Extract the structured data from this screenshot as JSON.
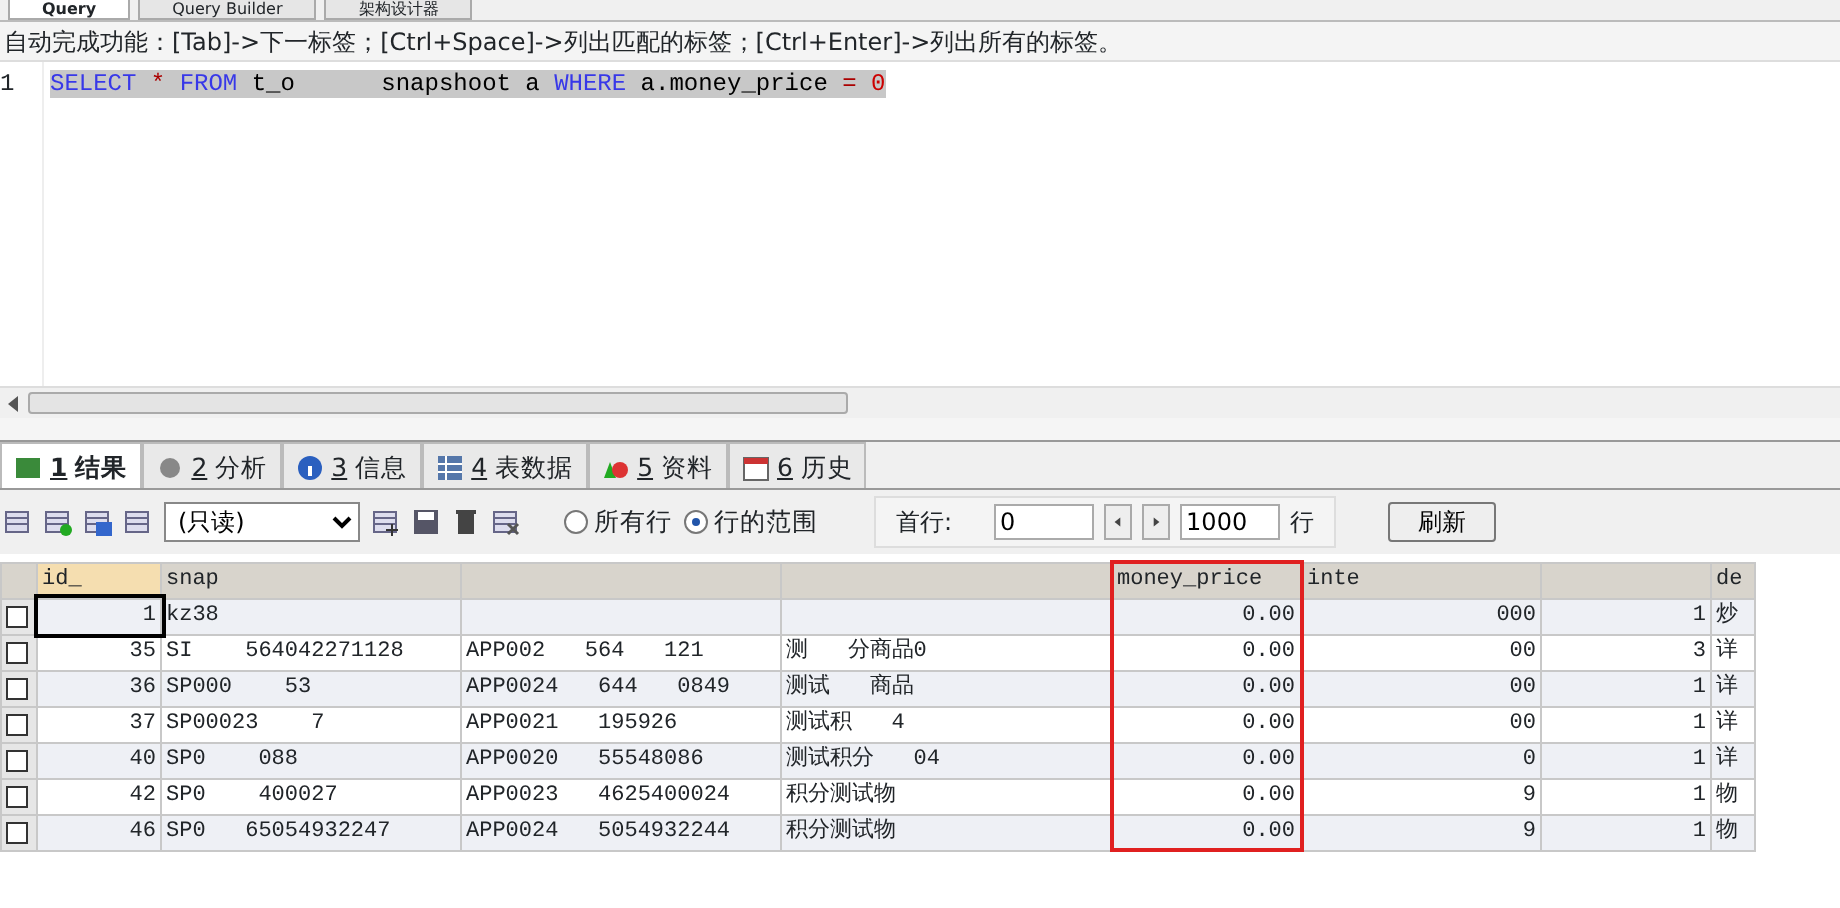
{
  "query_tabs": [
    {
      "label": "Query",
      "selected": true
    },
    {
      "label": "Query Builder",
      "selected": false
    },
    {
      "label": "架构设计器",
      "selected": false
    }
  ],
  "hint": "自动完成功能：[Tab]->下一标签；[Ctrl+Space]->列出匹配的标签；[Ctrl+Enter]->列出所有的标签。",
  "editor": {
    "line_number": "1",
    "tokens": [
      {
        "text": "SELECT",
        "kind": "keyword"
      },
      {
        "text": "*",
        "kind": "operator"
      },
      {
        "text": "FROM",
        "kind": "keyword"
      },
      {
        "text": "t_o      snapshoot a",
        "kind": "plain"
      },
      {
        "text": "WHERE",
        "kind": "keyword"
      },
      {
        "text": "a.money_price",
        "kind": "plain"
      },
      {
        "text": "=",
        "kind": "operator"
      },
      {
        "text": "0",
        "kind": "number"
      }
    ]
  },
  "result_tabs": [
    {
      "number": "1",
      "label": "结果",
      "selected": true
    },
    {
      "number": "2",
      "label": "分析",
      "selected": false
    },
    {
      "number": "3",
      "label": "信息",
      "selected": false
    },
    {
      "number": "4",
      "label": "表数据",
      "selected": false
    },
    {
      "number": "5",
      "label": "资料",
      "selected": false
    },
    {
      "number": "6",
      "label": "历史",
      "selected": false
    }
  ],
  "toolbar": {
    "mode": "(只读)",
    "radios": [
      {
        "label": "所有行",
        "selected": false
      },
      {
        "label": "行的范围",
        "selected": true
      }
    ],
    "first_row_label": "首行:",
    "first_row": "0",
    "row_count": "1000",
    "rows_label": "行",
    "refresh": "刷新"
  },
  "table": {
    "columns": [
      {
        "label": "id_",
        "kind": "numeric",
        "highlighted": false
      },
      {
        "label": "snap",
        "kind": "text",
        "highlighted": false
      },
      {
        "kind": "text",
        "highlighted": false
      },
      {
        "kind": "text",
        "highlighted": false
      },
      {
        "label": "money_price",
        "kind": "numeric",
        "highlighted": true
      },
      {
        "label": "inte",
        "kind": "numeric",
        "highlighted": false
      },
      {
        "kind": "numeric",
        "highlighted": false
      },
      {
        "label": "de",
        "kind": "text",
        "highlighted": false
      }
    ],
    "rows": [
      {
        "selected": false,
        "cells": [
          "1",
          "kz38",
          "",
          "",
          "0.00",
          "000",
          "1",
          "炒"
        ]
      },
      {
        "selected": false,
        "cells": [
          "35",
          "SI    564042271128",
          "APP002   564   121",
          "测   分商品0",
          "0.00",
          "00",
          "3",
          "详"
        ]
      },
      {
        "selected": false,
        "cells": [
          "36",
          "SP000    53",
          "APP0024   644   0849",
          "测试   商品",
          "0.00",
          "00",
          "1",
          "详"
        ]
      },
      {
        "selected": false,
        "cells": [
          "37",
          "SP00023    7",
          "APP0021   195926",
          "测试积   4",
          "0.00",
          "00",
          "1",
          "详"
        ]
      },
      {
        "selected": false,
        "cells": [
          "40",
          "SP0    088",
          "APP0020   55548086",
          "测试积分   04",
          "0.00",
          "0",
          "1",
          "详"
        ]
      },
      {
        "selected": false,
        "cells": [
          "42",
          "SP0    400027",
          "APP0023   4625400024",
          "积分测试物",
          "0.00",
          "9",
          "1",
          "物"
        ]
      },
      {
        "selected": false,
        "cells": [
          "46",
          "SP0   65054932247",
          "APP0024   5054932244",
          "积分测试物",
          "0.00",
          "9",
          "1",
          "物"
        ]
      }
    ]
  }
}
